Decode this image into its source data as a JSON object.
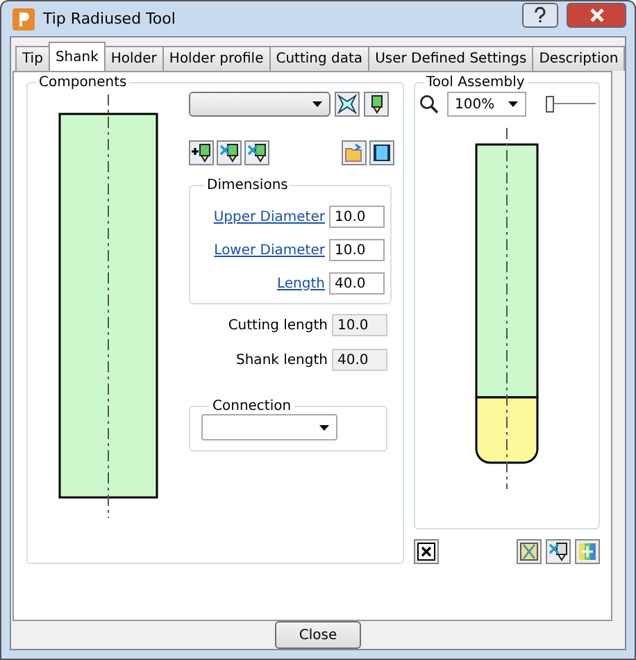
{
  "window": {
    "title": "Tip Radiused Tool"
  },
  "tabs": [
    {
      "label": "Tip",
      "selected": false
    },
    {
      "label": "Shank",
      "selected": true
    },
    {
      "label": "Holder",
      "selected": false
    },
    {
      "label": "Holder profile",
      "selected": false
    },
    {
      "label": "Cutting data",
      "selected": false
    },
    {
      "label": "User Defined Settings",
      "selected": false
    },
    {
      "label": "Description",
      "selected": false
    }
  ],
  "components": {
    "title": "Components",
    "dimensions": {
      "title": "Dimensions",
      "fields": [
        {
          "label": "Upper Diameter",
          "value": "10.0"
        },
        {
          "label": "Lower Diameter",
          "value": "10.0"
        },
        {
          "label": "Length",
          "value": "40.0"
        }
      ]
    },
    "readouts": [
      {
        "label": "Cutting length",
        "value": "10.0"
      },
      {
        "label": "Shank length",
        "value": "40.0"
      }
    ],
    "connection": {
      "title": "Connection"
    }
  },
  "tool_assembly": {
    "title": "Tool Assembly",
    "zoom": "100%",
    "zoom_slider": {
      "level": 0.0
    }
  },
  "buttons": [
    "Close"
  ]
}
